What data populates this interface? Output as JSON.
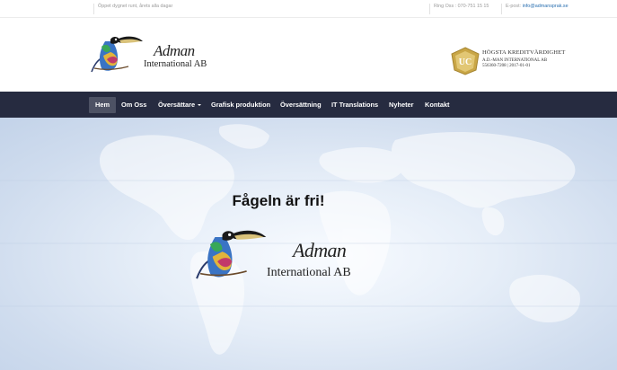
{
  "topbar": {
    "open_text": "Öppet dygnet runt, årets alla dagar",
    "phone_text": "Ring Oss : 070-751 15 15",
    "email_label": "E-post:",
    "email_link": "info@admansprak.se"
  },
  "header": {
    "logo_line1": "Adman",
    "logo_line2": "International AB",
    "badge_letters": "UC",
    "badge_title": "HÖGSTA KREDITVÄRDIGHET",
    "badge_company": "A.D.-MAN INTERNATIONAL AB",
    "badge_id": "556360-7208 | 2017-01-01"
  },
  "nav": {
    "items": [
      {
        "label": "Hem",
        "active": true
      },
      {
        "label": "Om Oss"
      },
      {
        "label": "Översättare",
        "dropdown": true
      },
      {
        "label": "Grafisk produktion"
      },
      {
        "label": "Översättning"
      },
      {
        "label": "IT Translations"
      },
      {
        "label": "Nyheter"
      },
      {
        "label": "Kontakt"
      }
    ]
  },
  "hero": {
    "title": "Fågeln är fri!",
    "logo_line1": "Adman",
    "logo_line2": "International AB"
  },
  "colors": {
    "nav_bg": "#262b40",
    "nav_active": "#4d5264",
    "link": "#2a6fb0",
    "badge_gold": "#c9a646"
  },
  "icons": {
    "logo": "toucan-bird-icon",
    "badge": "uc-shield-icon",
    "dropdown": "caret-down-icon"
  }
}
